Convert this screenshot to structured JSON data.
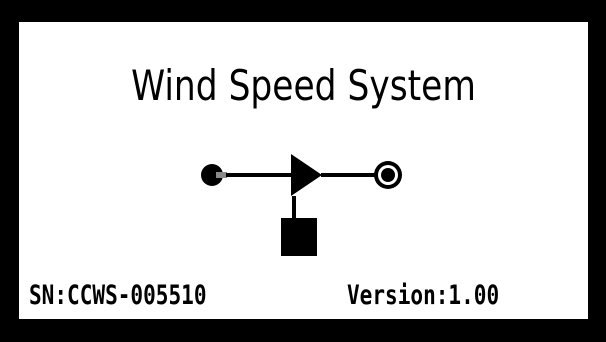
{
  "screen": {
    "title": "Wind Speed System",
    "logo_icon": "wind-speed-system-diagram-icon",
    "serial_number": "SN:CCWS-005510",
    "version": "Version:1.00"
  },
  "colors": {
    "background": "#000000",
    "screen": "#ffffff",
    "foreground": "#000000"
  }
}
